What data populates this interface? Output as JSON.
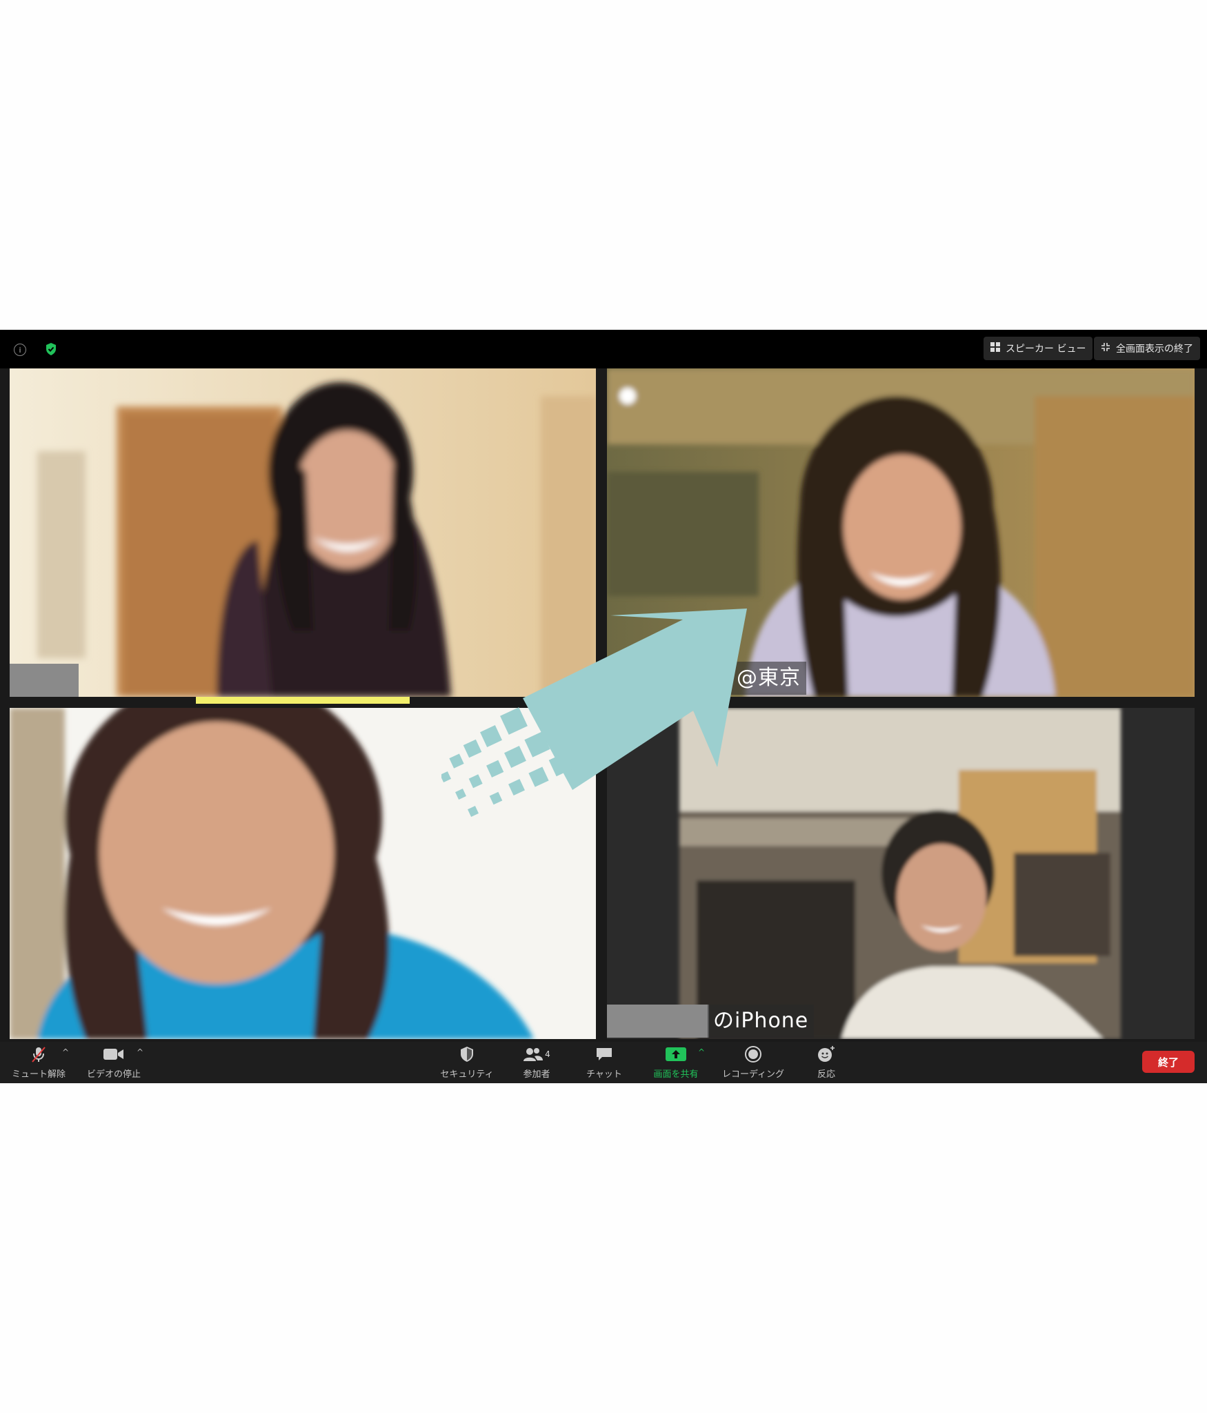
{
  "window": {
    "top_bar": {
      "info_icon": "info-icon",
      "security_icon": "shield-check-icon",
      "speaker_view_label": "スピーカー ビュー",
      "exit_fullscreen_label": "全画面表示の終了"
    },
    "participants": [
      {
        "position": "top-left",
        "name_label": "",
        "speaking": true
      },
      {
        "position": "top-right",
        "name_label": "@東京",
        "speaking": false
      },
      {
        "position": "bottom-left",
        "name_label": "",
        "speaking": false
      },
      {
        "position": "bottom-right",
        "name_label": "のiPhone",
        "speaking": false
      }
    ],
    "toolbar": {
      "unmute_label": "ミュート解除",
      "stop_video_label": "ビデオの停止",
      "security_label": "セキュリティ",
      "participants_label": "参加者",
      "participants_count": "4",
      "chat_label": "チャット",
      "share_screen_label": "画面を共有",
      "record_label": "レコーディング",
      "reactions_label": "反応",
      "end_label": "終了"
    }
  },
  "colors": {
    "share_green": "#21c25a",
    "end_red": "#d52b2b",
    "speaking_yellow": "#f2ef6b",
    "arrow_teal": "#9ccfcf"
  }
}
